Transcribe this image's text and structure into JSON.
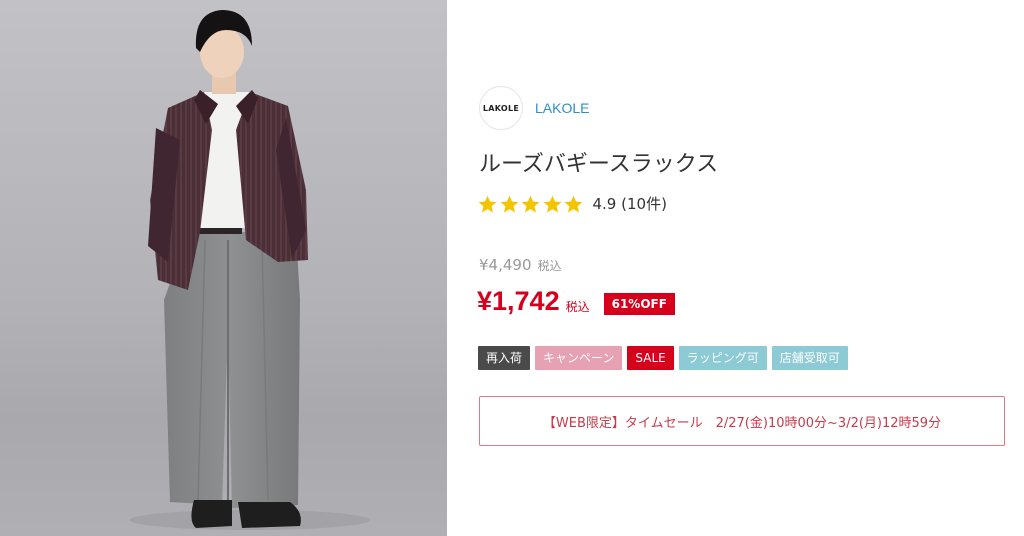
{
  "product": {
    "brand": {
      "logo_text": "LAKOLE",
      "name": "LAKOLE"
    },
    "title": "ルーズバギースラックス",
    "rating": {
      "value": 5,
      "max": 5,
      "score_text": "4.9",
      "count_text": "(10件)"
    },
    "price": {
      "original": "¥4,490",
      "original_tax": "税込",
      "sale": "¥1,742",
      "sale_tax": "税込",
      "discount_badge": "61%OFF"
    },
    "tags": [
      {
        "label": "再入荷",
        "color": "#4a4a4a"
      },
      {
        "label": "キャンペーン",
        "color": "#e6a1b2"
      },
      {
        "label": "SALE",
        "color": "#d6001c"
      },
      {
        "label": "ラッピング可",
        "color": "#8ccad6"
      },
      {
        "label": "店舗受取可",
        "color": "#8ccad6"
      }
    ],
    "sale_banner": "【WEB限定】タイムセール　2/27(金)10時00分~3/2(月)12時59分"
  },
  "colors": {
    "accent_red": "#d6001c",
    "brand_link": "#2f8fc4",
    "star": "#f5c400"
  }
}
